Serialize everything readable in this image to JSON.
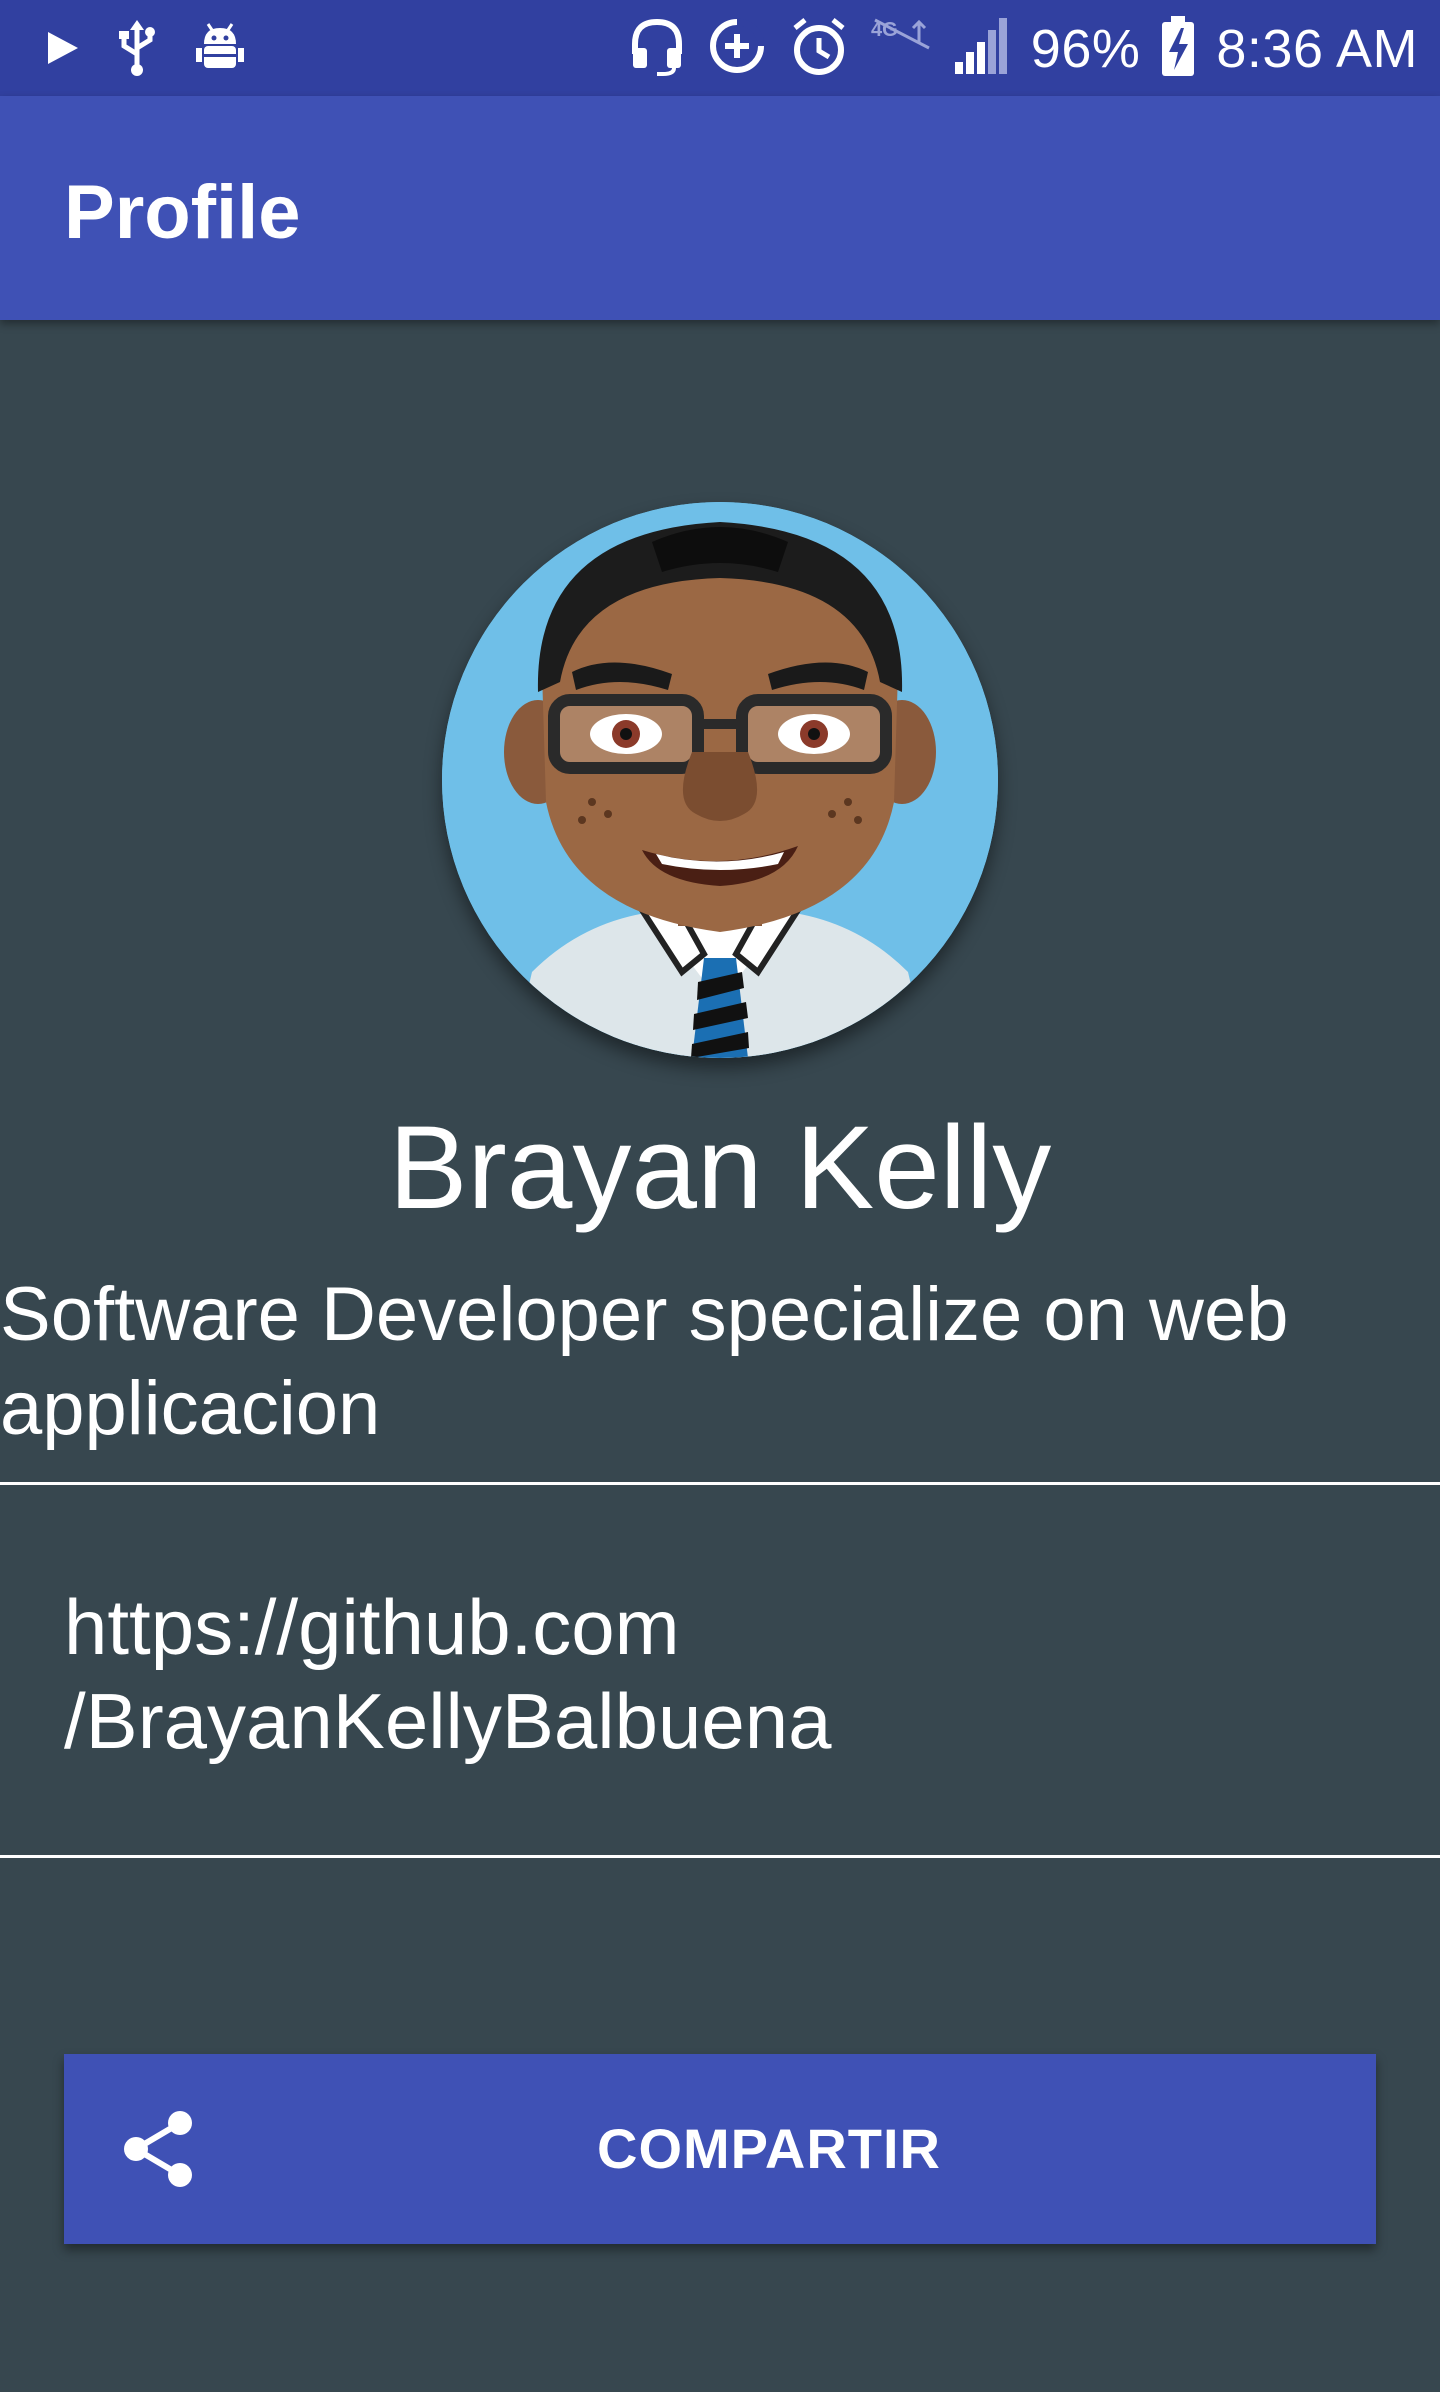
{
  "status_bar": {
    "battery": "96%",
    "time": "8:36 AM",
    "icons": [
      "play-icon",
      "usb-icon",
      "android-debug-icon",
      "headset-icon",
      "data-saver-icon",
      "alarm-icon",
      "lte-icon",
      "signal-icon",
      "battery-charging-icon"
    ]
  },
  "app_bar": {
    "title": "Profile"
  },
  "profile": {
    "avatar": "avatar-cartoon-man-glasses",
    "name": "Brayan Kelly",
    "bio": "Software Developer specialize on web applicacion",
    "link": "https://github.com\n/BrayanKellyBalbuena"
  },
  "share_button": {
    "label": "COMPARTIR",
    "icon": "share-icon"
  },
  "colors": {
    "status_bar": "#3140a0",
    "primary": "#3f51b5",
    "background": "#37474f",
    "text": "#ffffff"
  }
}
